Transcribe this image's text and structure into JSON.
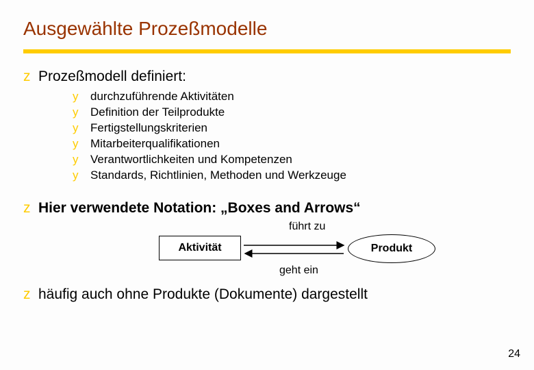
{
  "title": "Ausgewählte Prozeßmodelle",
  "bullets": {
    "z_marker": "z",
    "y_marker": "y",
    "b1": {
      "text": "Prozeßmodell definiert:",
      "subs": [
        "durchzuführende Aktivitäten",
        "Definition der Teilprodukte",
        "Fertigstellungskriterien",
        "Mitarbeiterqualifikationen",
        "Verantwortlichkeiten und Kompetenzen",
        "Standards, Richtlinien, Methoden und Werkzeuge"
      ]
    },
    "b2": {
      "text": "Hier verwendete Notation: „Boxes and Arrows“"
    },
    "b3": {
      "text": "häufig auch ohne Produkte (Dokumente) dargestellt"
    }
  },
  "diagram": {
    "activity": "Aktivität",
    "product": "Produkt",
    "leads_to": "führt zu",
    "enters": "geht ein"
  },
  "page_number": "24"
}
